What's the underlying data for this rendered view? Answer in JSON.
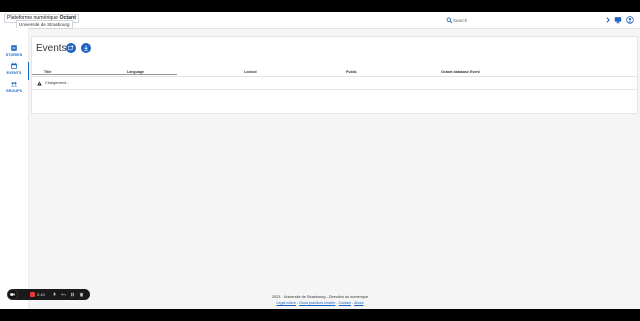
{
  "header": {
    "brand_prefix": "Plateforme numérique",
    "brand_name": "Octant",
    "institution": "Université de Strasbourg",
    "search_placeholder": "Search"
  },
  "sidebar": {
    "items": [
      {
        "label": "STORIES",
        "icon": "book-icon"
      },
      {
        "label": "EVENTS",
        "icon": "calendar-icon"
      },
      {
        "label": "GROUPS",
        "icon": "group-icon"
      }
    ],
    "active": "EVENTS"
  },
  "main": {
    "title": "Events",
    "columns": [
      "Title",
      "Language",
      "Locked",
      "Public",
      "Octant database Event"
    ],
    "empty_message": "Chargement..."
  },
  "footer": {
    "copyright": "2023 - Université de Strasbourg - Direction du numérique",
    "links": [
      "Legal notice",
      "Good practices charter",
      "Contact",
      "About"
    ],
    "separator": " - "
  },
  "recorder": {
    "time": "2:43"
  },
  "colors": {
    "accent": "#1e62c0",
    "sidebar_label": "#1565c0",
    "background": "#f5f5f5"
  }
}
